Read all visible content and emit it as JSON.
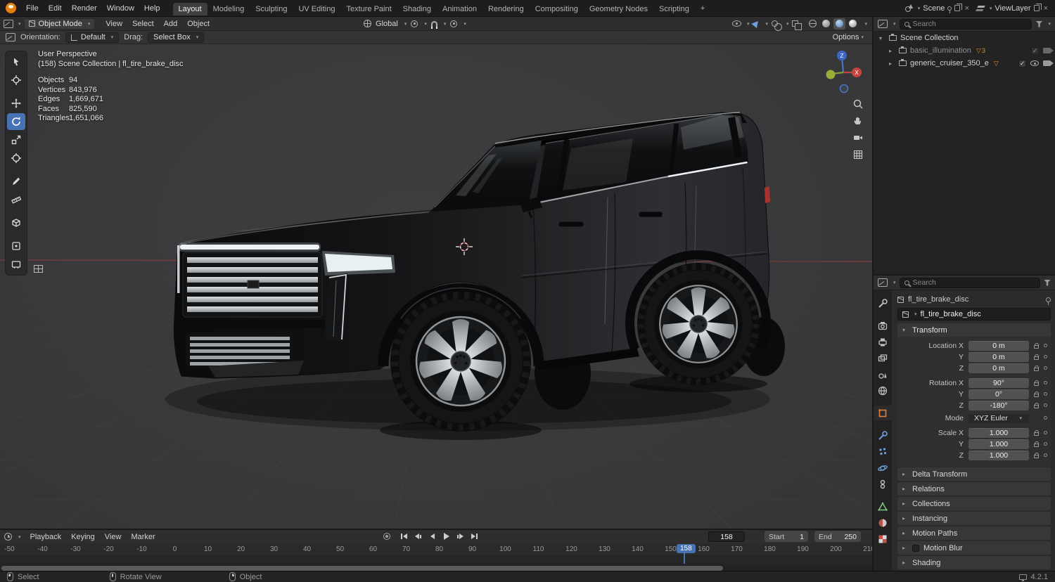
{
  "icons": {
    "chevron_down": "▾",
    "chevron_right": "▸",
    "close": "×",
    "check": "✓",
    "mesh_badge": "▽"
  },
  "topbar": {
    "menus": [
      "File",
      "Edit",
      "Render",
      "Window",
      "Help"
    ],
    "workspaces": [
      {
        "label": "Layout",
        "active": true
      },
      {
        "label": "Modeling"
      },
      {
        "label": "Sculpting"
      },
      {
        "label": "UV Editing"
      },
      {
        "label": "Texture Paint"
      },
      {
        "label": "Shading"
      },
      {
        "label": "Animation"
      },
      {
        "label": "Rendering"
      },
      {
        "label": "Compositing"
      },
      {
        "label": "Geometry Nodes"
      },
      {
        "label": "Scripting"
      }
    ],
    "add_workspace": "+",
    "scene_label": "Scene",
    "viewlayer_label": "ViewLayer"
  },
  "viewport": {
    "header": {
      "mode": "Object Mode",
      "menus": [
        "View",
        "Select",
        "Add",
        "Object"
      ],
      "orientation": "Global"
    },
    "tool_settings": {
      "orientation_label": "Orientation:",
      "orientation_value": "Default",
      "drag_label": "Drag:",
      "drag_value": "Select Box",
      "options_label": "Options"
    },
    "overlay": {
      "perspective": "User Perspective",
      "context": "(158) Scene Collection | fl_tire_brake_disc",
      "stats": [
        {
          "label": "Objects",
          "value": "94"
        },
        {
          "label": "Vertices",
          "value": "843,976"
        },
        {
          "label": "Edges",
          "value": "1,669,671"
        },
        {
          "label": "Faces",
          "value": "825,590"
        },
        {
          "label": "Triangles",
          "value": "1,651,066"
        }
      ]
    },
    "gizmo_axes": {
      "x": "X",
      "z": "Z"
    }
  },
  "outliner": {
    "search_placeholder": "Search",
    "rows": [
      {
        "label": "Scene Collection"
      },
      {
        "label": "basic_illumination",
        "badge": "3"
      },
      {
        "label": "generic_cruiser_350_e"
      }
    ]
  },
  "properties": {
    "search_placeholder": "Search",
    "breadcrumb": "fl_tire_brake_disc",
    "name_field": "fl_tire_brake_disc",
    "transform": {
      "title": "Transform",
      "rows": [
        {
          "label": "Location X",
          "value": "0 m",
          "lock": true
        },
        {
          "label": "Y",
          "value": "0 m",
          "lock": true
        },
        {
          "label": "Z",
          "value": "0 m",
          "lock": true
        },
        {
          "label": "Rotation X",
          "value": "90°",
          "lock": true
        },
        {
          "label": "Y",
          "value": "0°",
          "lock": true
        },
        {
          "label": "Z",
          "value": "-180°",
          "lock": true
        },
        {
          "label": "Mode",
          "value": "XYZ Euler",
          "dropdown": true
        },
        {
          "label": "Scale X",
          "value": "1.000",
          "lock": true
        },
        {
          "label": "Y",
          "value": "1.000",
          "lock": true
        },
        {
          "label": "Z",
          "value": "1.000",
          "lock": true
        }
      ]
    },
    "sections": [
      {
        "label": "Delta Transform"
      },
      {
        "label": "Relations"
      },
      {
        "label": "Collections"
      },
      {
        "label": "Instancing"
      },
      {
        "label": "Motion Paths"
      },
      {
        "label": "Motion Blur",
        "checkbox": true
      },
      {
        "label": "Shading"
      }
    ]
  },
  "timeline": {
    "menus": [
      "Playback",
      "Keying",
      "View",
      "Marker"
    ],
    "current_frame": "158",
    "start_label": "Start",
    "start_value": "1",
    "end_label": "End",
    "end_value": "250",
    "ticks": [
      "-50",
      "-40",
      "-30",
      "-20",
      "-10",
      "0",
      "10",
      "20",
      "30",
      "40",
      "50",
      "60",
      "70",
      "80",
      "90",
      "100",
      "110",
      "120",
      "130",
      "140",
      "150",
      "160",
      "170",
      "180",
      "190",
      "200",
      "210"
    ]
  },
  "statusbar": {
    "hints": [
      {
        "label": "Select"
      },
      {
        "label": "Rotate View"
      },
      {
        "label": "Object"
      }
    ],
    "version": "4.2.1"
  }
}
